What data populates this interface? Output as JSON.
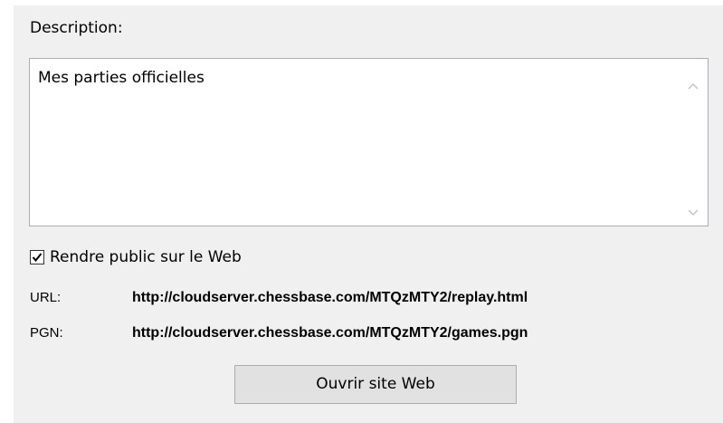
{
  "description": {
    "label": "Description:",
    "value": "Mes parties officielles"
  },
  "public_checkbox": {
    "label": "Rendre public sur le Web",
    "checked": true
  },
  "links": {
    "url_label": "URL:",
    "url_value": "http://cloudserver.chessbase.com/MTQzMTY2/replay.html",
    "pgn_label": "PGN:",
    "pgn_value": "http://cloudserver.chessbase.com/MTQzMTY2/games.pgn"
  },
  "open_button": {
    "label": "Ouvrir site Web"
  },
  "icons": {
    "scroll_up": "chevron-up-icon",
    "scroll_down": "chevron-down-icon",
    "checkmark": "checkmark-icon"
  },
  "colors": {
    "panel_bg": "#f0f0f0",
    "button_bg": "#e1e1e1",
    "border": "#abadb3"
  }
}
